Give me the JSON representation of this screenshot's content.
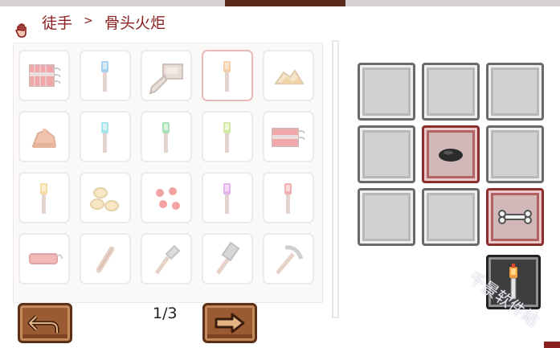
{
  "breadcrumb": {
    "root": "徒手",
    "separator": ">",
    "current": "骨头火炬"
  },
  "recipe_grid": {
    "rows": [
      [
        "dynamite-bundle",
        "blue-torch",
        "drill-gear",
        "torch",
        "pile-of-ash"
      ],
      [
        "cake-slice",
        "cyan-torch",
        "green-torch",
        "lime-torch",
        "dynamite-bundle"
      ],
      [
        "yellow-torch",
        "eggs",
        "red-berries",
        "purple-torch",
        "red-torch"
      ],
      [
        "rolled-scroll",
        "stick",
        "shovel",
        "hammer",
        "pickaxe"
      ]
    ],
    "selected_index": 3
  },
  "crafting_grid": {
    "slots": [
      "empty",
      "empty",
      "empty",
      "empty",
      "coal",
      "empty",
      "empty",
      "empty",
      "bone"
    ],
    "result": "bone-torch"
  },
  "pager": {
    "text": "1/3",
    "prev_icon": "return-arrow-icon",
    "next_icon": "right-arrow-icon"
  },
  "watermark": "千景软件站",
  "colors": {
    "breadcrumb": "#8b1f1f",
    "button": "#9a5a32",
    "highlight_slot": "#8d2e2e"
  }
}
